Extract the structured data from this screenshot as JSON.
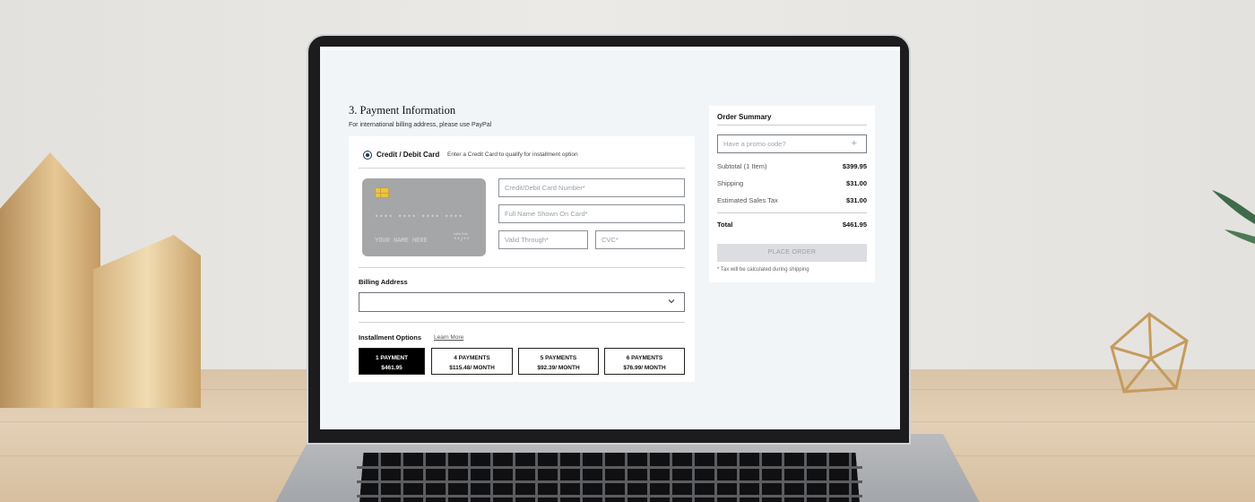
{
  "payment": {
    "title": "3. Payment Information",
    "subtitle": "For international billing address, please use PayPal",
    "method_label": "Credit / Debit Card",
    "method_note": "Enter a Credit Card to qualify for installment option",
    "card_preview": {
      "number_mask": "**** **** **** ****",
      "name_placeholder": "YOUR NAME HERE",
      "valid_label": "valid thru",
      "expiry_mask": "**/**"
    },
    "fields": {
      "card_number_placeholder": "Credit/Debit Card Number*",
      "full_name_placeholder": "Full Name Shown On Card*",
      "valid_through_placeholder": "Valid Through*",
      "cvc_placeholder": "CVC*"
    },
    "billing_label": "Billing Address",
    "billing_value": "",
    "installment_label": "Installment Options",
    "learn_more": "Learn More",
    "installments": [
      {
        "line1": "1 PAYMENT",
        "line2": "$461.95",
        "selected": true
      },
      {
        "line1": "4 PAYMENTS",
        "line2": "$115.48/ MONTH",
        "selected": false
      },
      {
        "line1": "5 PAYMENTS",
        "line2": "$92.39/ MONTH",
        "selected": false
      },
      {
        "line1": "6 PAYMENTS",
        "line2": "$76.99/ MONTH",
        "selected": false
      }
    ]
  },
  "summary": {
    "title": "Order Summary",
    "promo_placeholder": "Have a promo code?",
    "promo_icon": "plus-icon",
    "rows": [
      {
        "label": "Subtotal (1 Item)",
        "value": "$399.95"
      },
      {
        "label": "Shipping",
        "value": "$31.00"
      },
      {
        "label": "Estimated Sales Tax",
        "value": "$31.00"
      }
    ],
    "total_label": "Total",
    "total_value": "$461.95",
    "place_order": "PLACE ORDER",
    "tax_note": "* Tax will be calculated during shipping"
  },
  "colors": {
    "accent": "#1d2f5a",
    "selected_option": "#000000",
    "disabled_button": "#dcdde0"
  }
}
